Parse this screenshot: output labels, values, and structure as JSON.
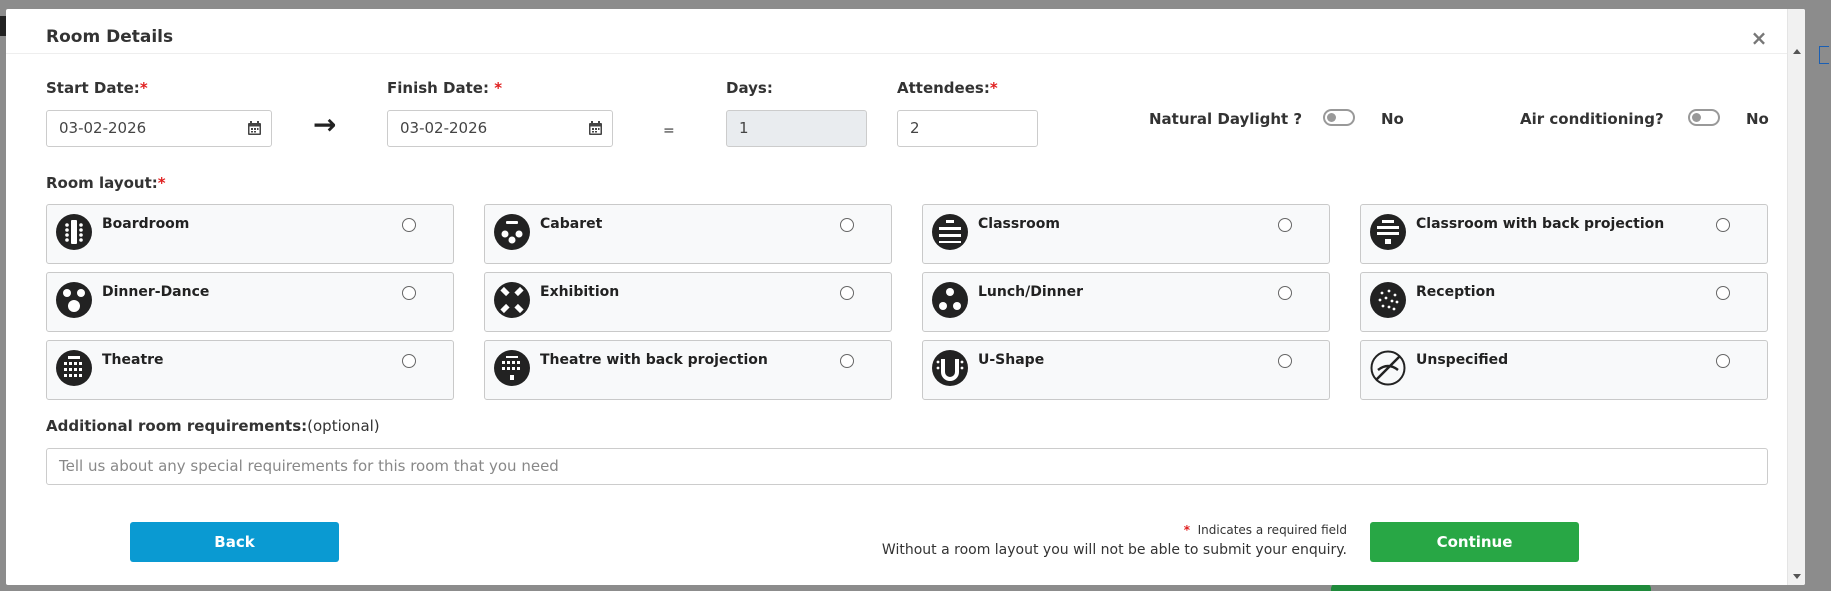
{
  "modal": {
    "title": "Room Details",
    "close_symbol": "×"
  },
  "fields": {
    "start_date": {
      "label": "Start Date:",
      "required_mark": "*",
      "value": "03-02-2026"
    },
    "finish_date": {
      "label": "Finish Date:",
      "required_mark": "*",
      "value": "03-02-2026"
    },
    "arrow": "→",
    "equals": "=",
    "days": {
      "label": "Days:",
      "value": "1"
    },
    "attendees": {
      "label": "Attendees:",
      "required_mark": "*",
      "value": "2"
    },
    "natural_daylight": {
      "label": "Natural Daylight ?",
      "value": "No"
    },
    "air_conditioning": {
      "label": "Air conditioning?",
      "value": "No"
    }
  },
  "room_layout": {
    "label": "Room layout:",
    "required_mark": "*",
    "options": [
      {
        "name": "Boardroom",
        "icon": "boardroom-icon"
      },
      {
        "name": "Cabaret",
        "icon": "cabaret-icon"
      },
      {
        "name": "Classroom",
        "icon": "classroom-icon"
      },
      {
        "name": "Classroom with back projection",
        "icon": "classroom-projection-icon"
      },
      {
        "name": "Dinner-Dance",
        "icon": "dinner-dance-icon"
      },
      {
        "name": "Exhibition",
        "icon": "exhibition-icon"
      },
      {
        "name": "Lunch/Dinner",
        "icon": "lunch-dinner-icon"
      },
      {
        "name": "Reception",
        "icon": "reception-icon"
      },
      {
        "name": "Theatre",
        "icon": "theatre-icon"
      },
      {
        "name": "Theatre with back projection",
        "icon": "theatre-projection-icon"
      },
      {
        "name": "U-Shape",
        "icon": "u-shape-icon"
      },
      {
        "name": "Unspecified",
        "icon": "unspecified-icon"
      }
    ]
  },
  "additional": {
    "label": "Additional room requirements:",
    "optional": "(optional)",
    "placeholder": "Tell us about any special requirements for this room that you need"
  },
  "footer": {
    "back_label": "Back",
    "continue_label": "Continue",
    "required_star": "*",
    "required_note": "Indicates a required field",
    "warning": "Without a room layout you will not be able to submit your enquiry."
  },
  "colors": {
    "primary_blue": "#0a9ad2",
    "success_green": "#28a745",
    "required_red": "#e02020"
  }
}
